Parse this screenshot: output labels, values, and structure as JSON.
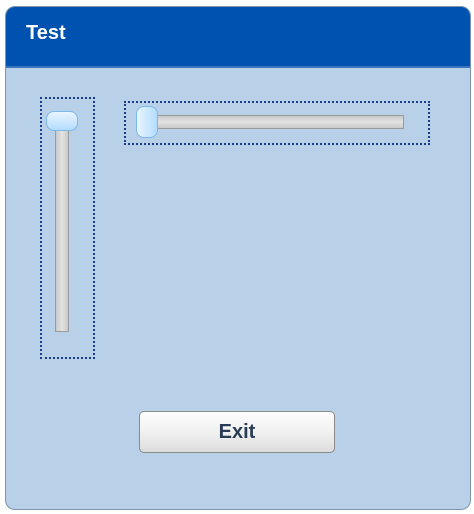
{
  "window": {
    "title": "Test",
    "title_bar_color": "#0052b0",
    "body_color": "#b9d1e8"
  },
  "vertical_slider": {
    "value_fraction": 0.0,
    "focused": true
  },
  "horizontal_slider": {
    "value_fraction": 0.0,
    "focused": true
  },
  "exit_button": {
    "label": "Exit"
  }
}
